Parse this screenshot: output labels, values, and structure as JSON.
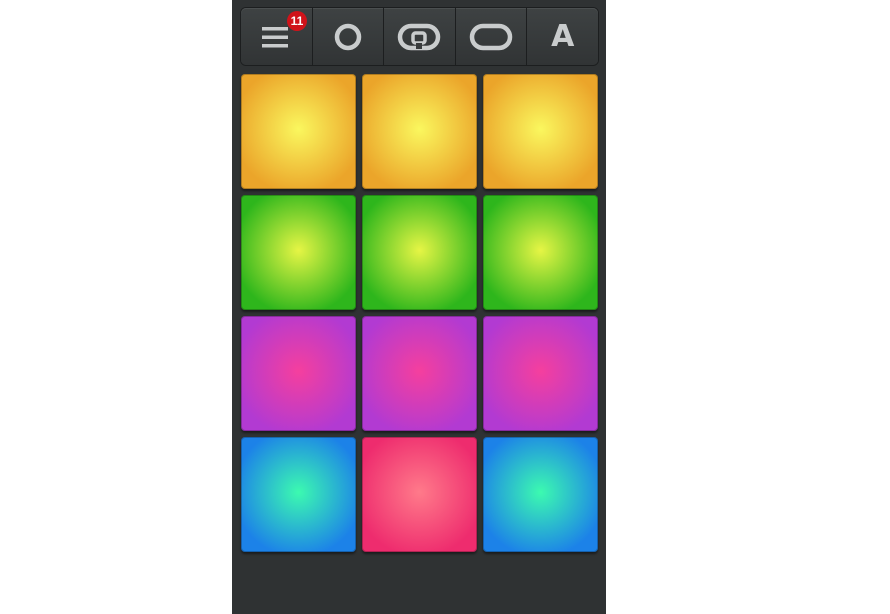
{
  "toolbar": {
    "buttons": [
      {
        "icon": "menu-icon",
        "badge": "11"
      },
      {
        "icon": "record-icon"
      },
      {
        "icon": "loop-icon"
      },
      {
        "icon": "loop-outline-icon"
      },
      {
        "icon": "letter-a-icon",
        "label": "A"
      }
    ],
    "icon_color": "#c9cccd",
    "badge_color": "#d0131a"
  },
  "pads": {
    "rows": [
      [
        {
          "center": "#faf75e",
          "edge": "#eba52a"
        },
        {
          "center": "#faf75e",
          "edge": "#eba52a"
        },
        {
          "center": "#faf75e",
          "edge": "#eba52a"
        }
      ],
      [
        {
          "center": "#e6f545",
          "edge": "#2eb61c"
        },
        {
          "center": "#e6f545",
          "edge": "#2eb61c"
        },
        {
          "center": "#e6f545",
          "edge": "#2eb61c"
        }
      ],
      [
        {
          "center": "#f53f9e",
          "edge": "#b23ad2"
        },
        {
          "center": "#f53f9e",
          "edge": "#b23ad2"
        },
        {
          "center": "#f53f9e",
          "edge": "#b23ad2"
        }
      ],
      [
        {
          "center": "#3cfab0",
          "edge": "#1c82e8"
        },
        {
          "center": "#ff7a8a",
          "edge": "#ee2c6e"
        },
        {
          "center": "#3cfab0",
          "edge": "#1c82e8"
        }
      ]
    ]
  }
}
